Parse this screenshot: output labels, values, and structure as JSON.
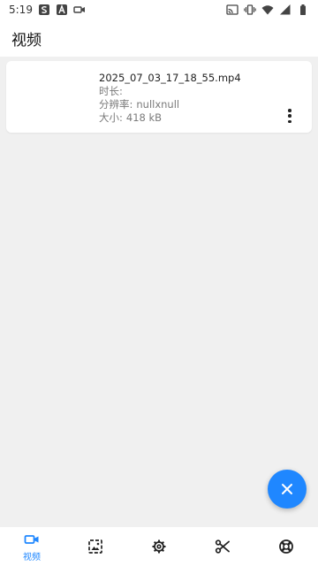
{
  "status_bar": {
    "time": "5:19",
    "left_icons": [
      "s-app-icon",
      "a-app-icon",
      "video-record-icon"
    ],
    "right_icons": [
      "cast-icon",
      "vibrate-icon",
      "wifi-icon",
      "signal-icon",
      "battery-icon"
    ]
  },
  "header": {
    "title": "视频"
  },
  "videos": [
    {
      "filename": "2025_07_03_17_18_55.mp4",
      "duration_label": "时长:",
      "duration_value": "",
      "resolution_label": "分辨率:",
      "resolution_value": "nullxnull",
      "size_label": "大小:",
      "size_value": "418 kB"
    }
  ],
  "fab": {
    "icon": "close-icon"
  },
  "bottom_nav": {
    "active_color": "#1f87ff",
    "items": [
      {
        "icon": "video-camera-icon",
        "label": "视频",
        "active": true
      },
      {
        "icon": "image-icon",
        "label": "",
        "active": false
      },
      {
        "icon": "gear-icon",
        "label": "",
        "active": false
      },
      {
        "icon": "scissors-icon",
        "label": "",
        "active": false
      },
      {
        "icon": "lifebuoy-icon",
        "label": "",
        "active": false
      }
    ]
  }
}
